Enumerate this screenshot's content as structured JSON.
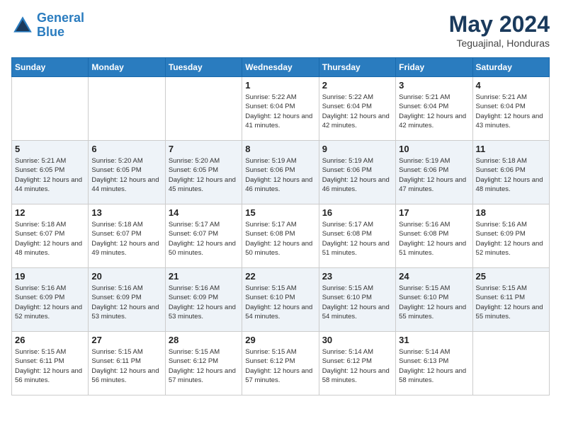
{
  "logo": {
    "line1": "General",
    "line2": "Blue"
  },
  "title": "May 2024",
  "subtitle": "Teguajinal, Honduras",
  "days_of_week": [
    "Sunday",
    "Monday",
    "Tuesday",
    "Wednesday",
    "Thursday",
    "Friday",
    "Saturday"
  ],
  "weeks": [
    [
      {
        "day": "",
        "info": ""
      },
      {
        "day": "",
        "info": ""
      },
      {
        "day": "",
        "info": ""
      },
      {
        "day": "1",
        "info": "Sunrise: 5:22 AM\nSunset: 6:04 PM\nDaylight: 12 hours\nand 41 minutes."
      },
      {
        "day": "2",
        "info": "Sunrise: 5:22 AM\nSunset: 6:04 PM\nDaylight: 12 hours\nand 42 minutes."
      },
      {
        "day": "3",
        "info": "Sunrise: 5:21 AM\nSunset: 6:04 PM\nDaylight: 12 hours\nand 42 minutes."
      },
      {
        "day": "4",
        "info": "Sunrise: 5:21 AM\nSunset: 6:04 PM\nDaylight: 12 hours\nand 43 minutes."
      }
    ],
    [
      {
        "day": "5",
        "info": "Sunrise: 5:21 AM\nSunset: 6:05 PM\nDaylight: 12 hours\nand 44 minutes."
      },
      {
        "day": "6",
        "info": "Sunrise: 5:20 AM\nSunset: 6:05 PM\nDaylight: 12 hours\nand 44 minutes."
      },
      {
        "day": "7",
        "info": "Sunrise: 5:20 AM\nSunset: 6:05 PM\nDaylight: 12 hours\nand 45 minutes."
      },
      {
        "day": "8",
        "info": "Sunrise: 5:19 AM\nSunset: 6:06 PM\nDaylight: 12 hours\nand 46 minutes."
      },
      {
        "day": "9",
        "info": "Sunrise: 5:19 AM\nSunset: 6:06 PM\nDaylight: 12 hours\nand 46 minutes."
      },
      {
        "day": "10",
        "info": "Sunrise: 5:19 AM\nSunset: 6:06 PM\nDaylight: 12 hours\nand 47 minutes."
      },
      {
        "day": "11",
        "info": "Sunrise: 5:18 AM\nSunset: 6:06 PM\nDaylight: 12 hours\nand 48 minutes."
      }
    ],
    [
      {
        "day": "12",
        "info": "Sunrise: 5:18 AM\nSunset: 6:07 PM\nDaylight: 12 hours\nand 48 minutes."
      },
      {
        "day": "13",
        "info": "Sunrise: 5:18 AM\nSunset: 6:07 PM\nDaylight: 12 hours\nand 49 minutes."
      },
      {
        "day": "14",
        "info": "Sunrise: 5:17 AM\nSunset: 6:07 PM\nDaylight: 12 hours\nand 50 minutes."
      },
      {
        "day": "15",
        "info": "Sunrise: 5:17 AM\nSunset: 6:08 PM\nDaylight: 12 hours\nand 50 minutes."
      },
      {
        "day": "16",
        "info": "Sunrise: 5:17 AM\nSunset: 6:08 PM\nDaylight: 12 hours\nand 51 minutes."
      },
      {
        "day": "17",
        "info": "Sunrise: 5:16 AM\nSunset: 6:08 PM\nDaylight: 12 hours\nand 51 minutes."
      },
      {
        "day": "18",
        "info": "Sunrise: 5:16 AM\nSunset: 6:09 PM\nDaylight: 12 hours\nand 52 minutes."
      }
    ],
    [
      {
        "day": "19",
        "info": "Sunrise: 5:16 AM\nSunset: 6:09 PM\nDaylight: 12 hours\nand 52 minutes."
      },
      {
        "day": "20",
        "info": "Sunrise: 5:16 AM\nSunset: 6:09 PM\nDaylight: 12 hours\nand 53 minutes."
      },
      {
        "day": "21",
        "info": "Sunrise: 5:16 AM\nSunset: 6:09 PM\nDaylight: 12 hours\nand 53 minutes."
      },
      {
        "day": "22",
        "info": "Sunrise: 5:15 AM\nSunset: 6:10 PM\nDaylight: 12 hours\nand 54 minutes."
      },
      {
        "day": "23",
        "info": "Sunrise: 5:15 AM\nSunset: 6:10 PM\nDaylight: 12 hours\nand 54 minutes."
      },
      {
        "day": "24",
        "info": "Sunrise: 5:15 AM\nSunset: 6:10 PM\nDaylight: 12 hours\nand 55 minutes."
      },
      {
        "day": "25",
        "info": "Sunrise: 5:15 AM\nSunset: 6:11 PM\nDaylight: 12 hours\nand 55 minutes."
      }
    ],
    [
      {
        "day": "26",
        "info": "Sunrise: 5:15 AM\nSunset: 6:11 PM\nDaylight: 12 hours\nand 56 minutes."
      },
      {
        "day": "27",
        "info": "Sunrise: 5:15 AM\nSunset: 6:11 PM\nDaylight: 12 hours\nand 56 minutes."
      },
      {
        "day": "28",
        "info": "Sunrise: 5:15 AM\nSunset: 6:12 PM\nDaylight: 12 hours\nand 57 minutes."
      },
      {
        "day": "29",
        "info": "Sunrise: 5:15 AM\nSunset: 6:12 PM\nDaylight: 12 hours\nand 57 minutes."
      },
      {
        "day": "30",
        "info": "Sunrise: 5:14 AM\nSunset: 6:12 PM\nDaylight: 12 hours\nand 58 minutes."
      },
      {
        "day": "31",
        "info": "Sunrise: 5:14 AM\nSunset: 6:13 PM\nDaylight: 12 hours\nand 58 minutes."
      },
      {
        "day": "",
        "info": ""
      }
    ]
  ]
}
